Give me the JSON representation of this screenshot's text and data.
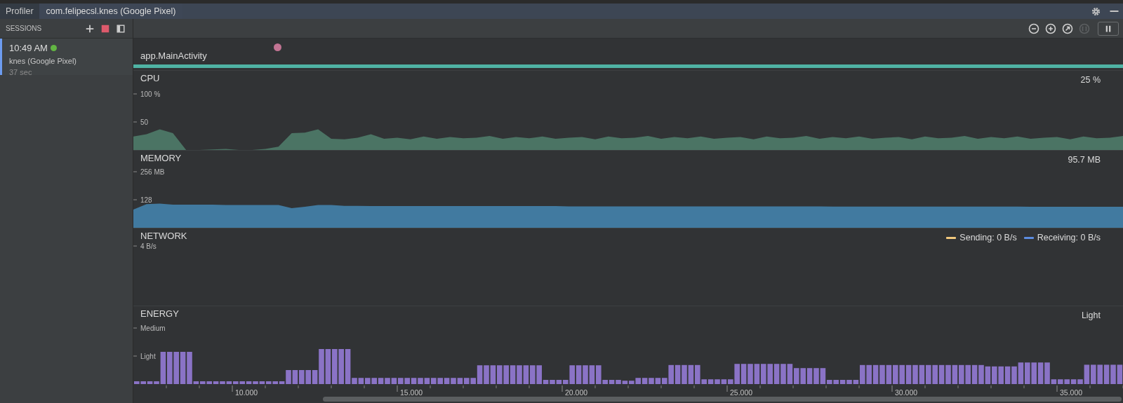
{
  "window": {
    "title": "Profiler"
  },
  "tabs": [
    {
      "label": "com.felipecsl.knes (Google Pixel)",
      "selected": true
    }
  ],
  "window_actions": [
    {
      "kind": "settings"
    },
    {
      "kind": "minimize"
    }
  ],
  "sessions": {
    "title": "SESSIONS",
    "actions": [
      {
        "kind": "add"
      },
      {
        "kind": "stop"
      },
      {
        "kind": "panel"
      }
    ],
    "items": [
      {
        "time": "10:49 AM",
        "live": true,
        "name": "knes (Google Pixel)",
        "duration": "37 sec",
        "selected": true
      }
    ]
  },
  "toolbar": [
    {
      "kind": "zoom-out",
      "disabled": false
    },
    {
      "kind": "zoom-in",
      "disabled": false
    },
    {
      "kind": "reset-zoom",
      "disabled": false
    },
    {
      "kind": "attach",
      "disabled": true
    },
    {
      "kind": "pause",
      "disabled": false
    }
  ],
  "activity": {
    "label": "app.MainActivity"
  },
  "monitors": [
    {
      "kind": "cpu",
      "title": "CPU",
      "reading": "25 %",
      "axis_labels": [
        "100 %",
        "50"
      ]
    },
    {
      "kind": "memory",
      "title": "MEMORY",
      "reading": "95.7 MB",
      "axis_labels": [
        "256 MB",
        "128"
      ]
    },
    {
      "kind": "network",
      "title": "NETWORK",
      "axis_labels": [
        "4 B/s"
      ],
      "legend": [
        {
          "label": "Sending: 0 B/s",
          "color": "#f2c97d"
        },
        {
          "label": "Receiving: 0 B/s",
          "color": "#5c8de0"
        }
      ]
    },
    {
      "kind": "energy",
      "title": "ENERGY",
      "reading": "Light",
      "axis_labels": [
        "Medium",
        "Light"
      ]
    }
  ],
  "timeline": {
    "ticks": [
      "10.000",
      "15.000",
      "20.000",
      "25.000",
      "30.000",
      "35.000"
    ]
  }
}
